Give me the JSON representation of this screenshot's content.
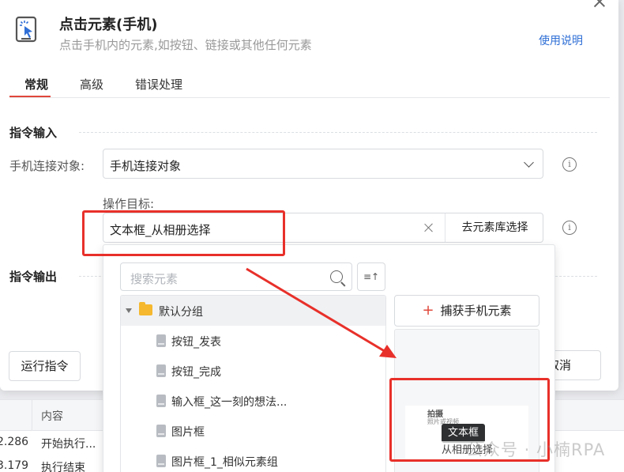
{
  "dialog": {
    "title": "点击元素(手机)",
    "subtitle": "点击手机内的元素,如按钮、链接或其他任何元素",
    "help_link": "使用说明",
    "icon": "tap-cursor-icon"
  },
  "tabs": [
    {
      "label": "常规",
      "active": true
    },
    {
      "label": "高级",
      "active": false
    },
    {
      "label": "错误处理",
      "active": false
    }
  ],
  "input_section": {
    "title": "指令输入",
    "phone_label": "手机连接对象:",
    "phone_value": "手机连接对象",
    "target_label": "操作目标:",
    "target_value": "文本框_从相册选择",
    "library_button": "去元素库选择"
  },
  "output_section": {
    "title": "指令输出"
  },
  "footer": {
    "run_button": "运行指令",
    "cancel_button": "取消"
  },
  "popup": {
    "search_placeholder": "搜索元素",
    "sort_icon": "≡↑",
    "group_label": "默认分组",
    "items": [
      "按钮_发表",
      "按钮_完成",
      "输入框_这一刻的想法...",
      "图片框",
      "图片框_1_相似元素组"
    ],
    "capture_button": "捕获手机元素",
    "preview_title": "拍摄",
    "preview_sub": "照片或视频",
    "tooltip": "文本框",
    "preview_label": "从相册选择"
  },
  "background_table": {
    "header_content": "内容",
    "rows": [
      {
        "time": "2.286",
        "content": "开始执行..."
      },
      {
        "time": "3.179",
        "content": "执行结束"
      }
    ]
  },
  "watermark": "公众号 · 小楠RPA",
  "colors": {
    "accent": "#e0483c",
    "link": "#2f6fd6",
    "annotation": "#e8302a"
  }
}
